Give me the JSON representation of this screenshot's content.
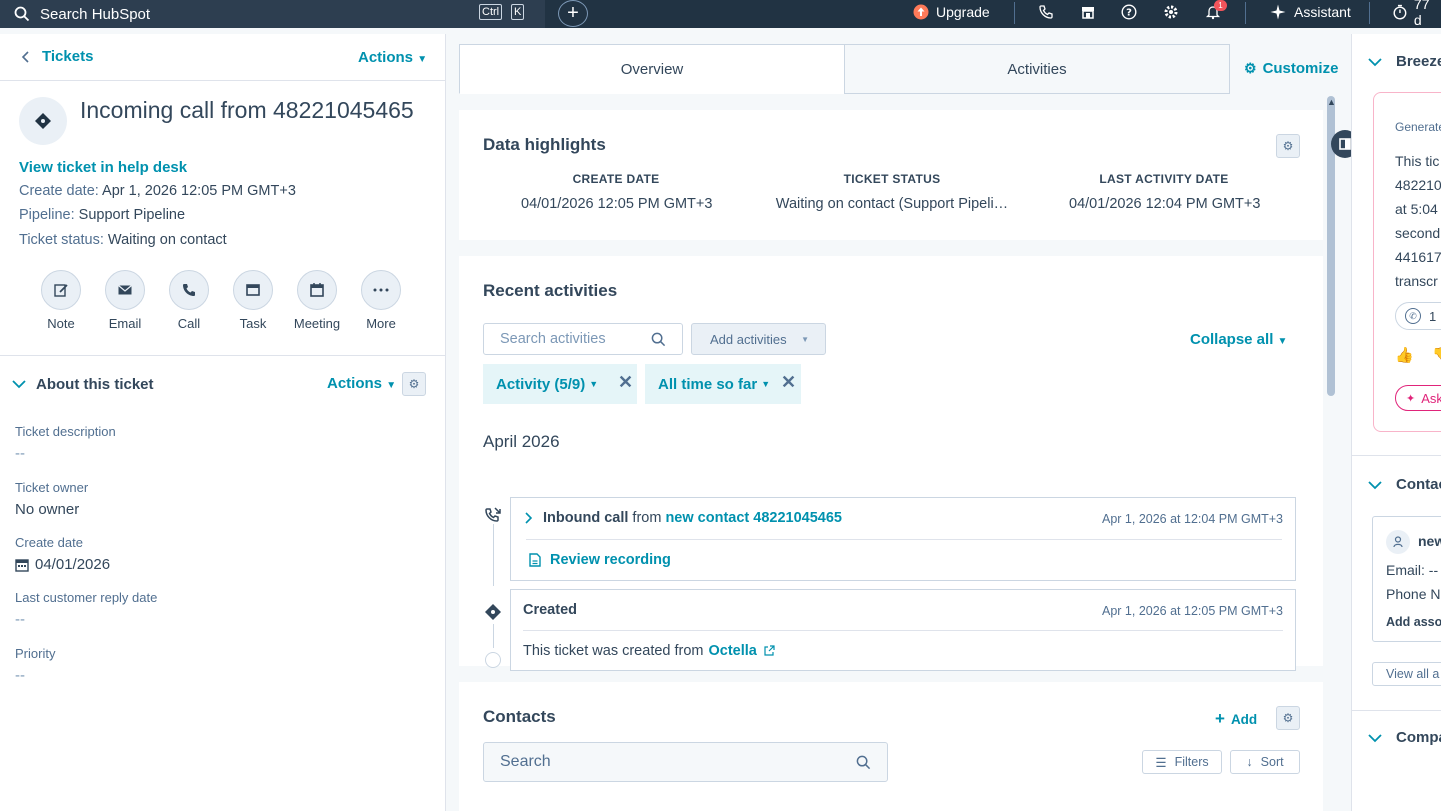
{
  "topbar": {
    "search_placeholder": "Search HubSpot",
    "kbd1": "Ctrl",
    "kbd2": "K",
    "plus": "+",
    "upgrade": "Upgrade",
    "notif_count": "1",
    "assistant": "Assistant",
    "timer": "77 d"
  },
  "left": {
    "back_label": "Tickets",
    "actions_label": "Actions",
    "title": "Incoming call from 48221045465",
    "view_help": "View ticket in help desk",
    "create_date_label": "Create date:",
    "create_date_value": "Apr 1, 2026 12:05 PM GMT+3",
    "pipeline_label": "Pipeline:",
    "pipeline_value": "Support Pipeline",
    "status_label": "Ticket status:",
    "status_value": "Waiting on contact",
    "actions": [
      {
        "label": "Note"
      },
      {
        "label": "Email"
      },
      {
        "label": "Call"
      },
      {
        "label": "Task"
      },
      {
        "label": "Meeting"
      },
      {
        "label": "More"
      }
    ],
    "about_title": "About this ticket",
    "about_actions": "Actions",
    "props": [
      {
        "label": "Ticket description",
        "value": "--"
      },
      {
        "label": "Ticket owner",
        "value": "No owner"
      },
      {
        "label": "Create date",
        "value": "04/01/2026"
      },
      {
        "label": "Last customer reply date",
        "value": "--"
      },
      {
        "label": "Priority",
        "value": "--"
      }
    ]
  },
  "tabs": {
    "overview": "Overview",
    "activities": "Activities",
    "customize": "Customize"
  },
  "highlights": {
    "title": "Data highlights",
    "cols": [
      {
        "header": "CREATE DATE",
        "value": "04/01/2026 12:05 PM GMT+3"
      },
      {
        "header": "TICKET STATUS",
        "value": "Waiting on contact (Support Pipeli…"
      },
      {
        "header": "LAST ACTIVITY DATE",
        "value": "04/01/2026 12:04 PM GMT+3"
      }
    ]
  },
  "recent": {
    "title": "Recent activities",
    "search_placeholder": "Search activities",
    "add_activities": "Add activities",
    "collapse_all": "Collapse all",
    "filter_activity": "Activity (5/9)",
    "filter_time": "All time so far",
    "month": "April 2026",
    "call": {
      "bold": "Inbound call",
      "from": "from",
      "contact": "new contact 48221045465",
      "time": "Apr 1, 2026 at 12:04 PM GMT+3",
      "review": "Review recording"
    },
    "created": {
      "title": "Created",
      "time": "Apr 1, 2026 at 12:05 PM GMT+3",
      "body": "This ticket was created from",
      "source": "Octella"
    }
  },
  "contacts": {
    "title": "Contacts",
    "add": "Add",
    "search_placeholder": "Search",
    "filters": "Filters",
    "sort": "Sort"
  },
  "right": {
    "breeze": "Breeze",
    "generated": "Generate",
    "summary_lines": [
      "This tic",
      "482210",
      "at 5:04",
      "second",
      "441617",
      "transcr"
    ],
    "ask": "Ask",
    "pill_count": "1",
    "contacts": "Contac",
    "contact_name": "new",
    "email_label": "Email: --",
    "phone_label": "Phone N",
    "add_assoc": "Add asso",
    "view_all": "View all a",
    "companies": "Compa"
  },
  "colors": {
    "topbar": "#213343",
    "link": "#0091ae",
    "text": "#33475b",
    "breeze_border": "#f8b4c9"
  }
}
